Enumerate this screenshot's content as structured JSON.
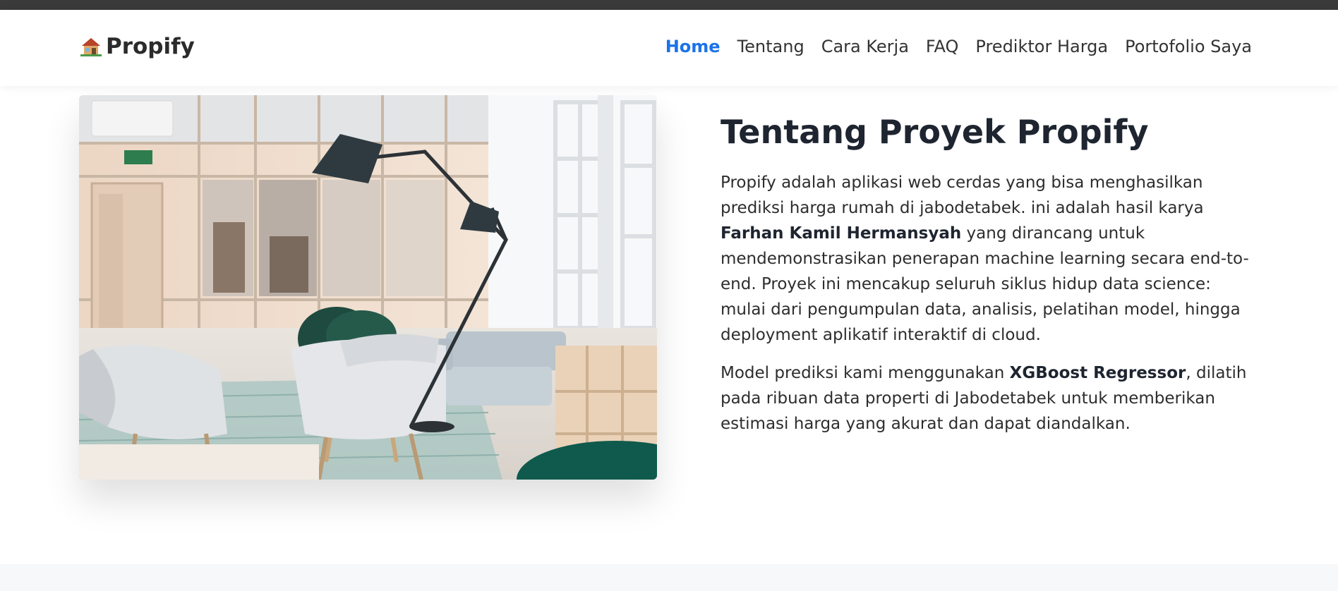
{
  "brand": {
    "name": "Propify",
    "icon": "house-icon"
  },
  "nav": {
    "items": [
      {
        "label": "Home",
        "active": true
      },
      {
        "label": "Tentang",
        "active": false
      },
      {
        "label": "Cara Kerja",
        "active": false
      },
      {
        "label": "FAQ",
        "active": false
      },
      {
        "label": "Prediktor Harga",
        "active": false
      },
      {
        "label": "Portofolio Saya",
        "active": false
      }
    ]
  },
  "about": {
    "title": "Tentang Proyek Propify",
    "p1": {
      "part1": "Propify adalah aplikasi web cerdas yang bisa menghasilkan prediksi harga rumah di jabodetabek. ini adalah hasil karya ",
      "author": "Farhan Kamil Hermansyah",
      "part2": " yang dirancang untuk mendemonstrasikan penerapan machine learning secara end-to-end. Proyek ini mencakup seluruh siklus hidup data science: mulai dari pengumpulan data, analisis, pelatihan model, hingga deployment aplikatif interaktif di cloud."
    },
    "p2": {
      "part1": "Model prediksi kami menggunakan ",
      "model": "XGBoost Regressor",
      "part2": ", dilatih pada ribuan data properti di Jabodetabek untuk memberikan estimasi harga yang akurat dan dapat diandalkan."
    }
  },
  "colors": {
    "accent": "#1a73e8",
    "heading": "#1e2530",
    "text": "#2d2d2d"
  }
}
